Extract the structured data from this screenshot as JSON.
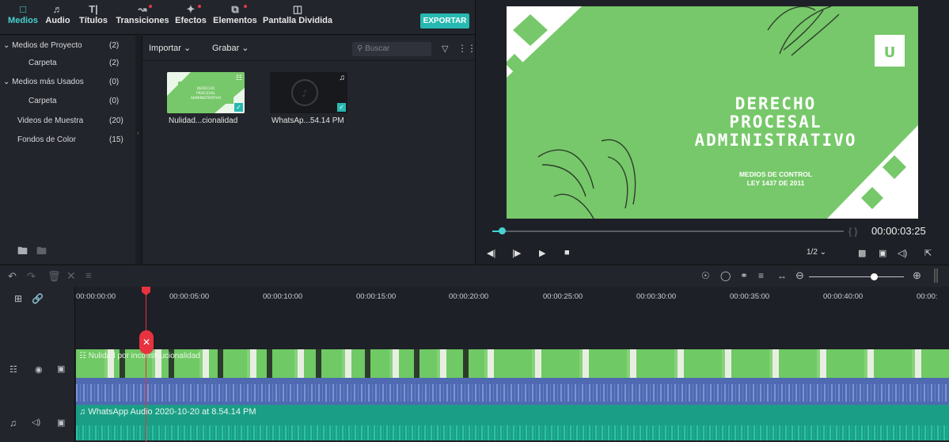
{
  "tabs": [
    {
      "label": "Medios",
      "icon": "folder-icon",
      "active": true
    },
    {
      "label": "Audio",
      "icon": "music-note-icon"
    },
    {
      "label": "Títulos",
      "icon": "text-icon"
    },
    {
      "label": "Transiciones",
      "icon": "transition-icon"
    },
    {
      "label": "Efectos",
      "icon": "effects-icon"
    },
    {
      "label": "Elementos",
      "icon": "elements-icon"
    },
    {
      "label": "Pantalla Dividida",
      "icon": "split-screen-icon"
    }
  ],
  "export_label": "EXPORTAR",
  "library": [
    {
      "label": "Medios de Proyecto",
      "count": "(2)",
      "expanded": true
    },
    {
      "label": "Carpeta",
      "count": "(2)",
      "indent": true
    },
    {
      "label": "Medios más Usados",
      "count": "(0)",
      "expanded": true
    },
    {
      "label": "Carpeta",
      "count": "(0)",
      "indent": true
    },
    {
      "label": "Videos de Muestra",
      "count": "(20)"
    },
    {
      "label": "Fondos de Color",
      "count": "(15)"
    }
  ],
  "media_toolbar": {
    "import_label": "Importar",
    "record_label": "Grabar",
    "search_placeholder": "Buscar"
  },
  "media_items": [
    {
      "label": "Nulidad...cionalidad"
    },
    {
      "label": "WhatsAp...54.14 PM"
    }
  ],
  "preview": {
    "title_lines": [
      "DERECHO",
      "PROCESAL",
      "ADMINISTRATIVO"
    ],
    "subtitle_lines": [
      "MEDIOS DE CONTROL",
      "LEY 1437 DE 2011"
    ],
    "timecode": "00:00:03:25",
    "zoom": "1/2",
    "progress": 0.03
  },
  "ruler": [
    "00:00:00:00",
    "00:00:05:00",
    "00:00:10:00",
    "00:00:15:00",
    "00:00:20:00",
    "00:00:25:00",
    "00:00:30:00",
    "00:00:35:00",
    "00:00:40:00",
    "00:00:"
  ],
  "video_clip_label": "Nulidad por inconstitucionalidad",
  "audio_clip_label": "WhatsApp Audio 2020-10-20 at 8.54.14 PM",
  "colors": {
    "accent": "#45d2d0",
    "export": "#27b9b1",
    "playhead": "#e8323f",
    "slide_green": "#77c86a"
  }
}
